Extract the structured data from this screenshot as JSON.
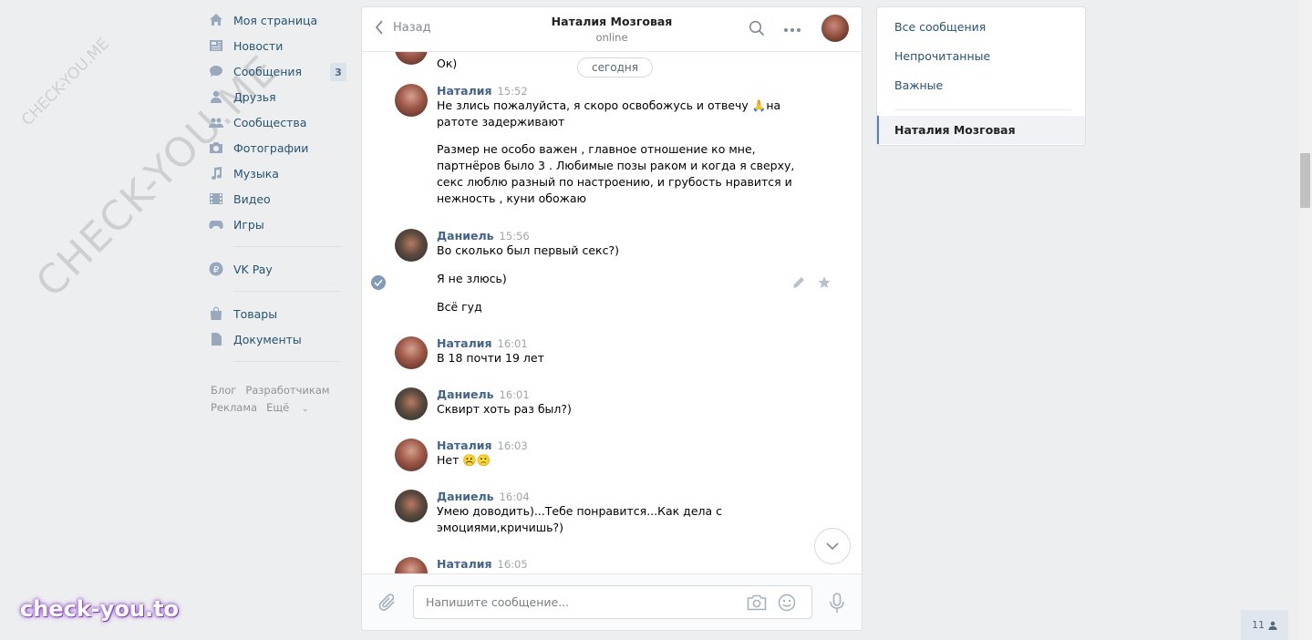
{
  "watermarks": {
    "big": "CHECK-YOU.ME",
    "small": "CHECK-YOU.ME",
    "brand": "check-you.to"
  },
  "nav": {
    "items": [
      {
        "label": "Моя страница",
        "icon": "home-icon"
      },
      {
        "label": "Новости",
        "icon": "news-icon"
      },
      {
        "label": "Сообщения",
        "icon": "messages-icon",
        "badge": "3"
      },
      {
        "label": "Друзья",
        "icon": "friends-icon"
      },
      {
        "label": "Сообщества",
        "icon": "groups-icon"
      },
      {
        "label": "Фотографии",
        "icon": "camera-icon"
      },
      {
        "label": "Музыка",
        "icon": "music-icon"
      },
      {
        "label": "Видео",
        "icon": "video-icon"
      },
      {
        "label": "Игры",
        "icon": "gamepad-icon"
      }
    ],
    "vkpay": "VK Pay",
    "goods": "Товары",
    "documents": "Документы",
    "footer": {
      "blog": "Блог",
      "developers": "Разработчикам",
      "ads": "Реклама",
      "more": "Ещё"
    }
  },
  "chat": {
    "back_label": "Назад",
    "title": "Наталия Мозговая",
    "status": "online",
    "date_pill": "сегодня",
    "partial_text": "Ок)",
    "messages": [
      {
        "author": "Наталия",
        "time": "15:52",
        "lines": [
          "Не злись пожалуйста, я скоро освобожусь и отвечу 🙏на",
          "ратоте задерживают"
        ],
        "para": [
          "Размер не особо важен , главное отношение ко мне,",
          "партнёров было 3 . Любимые позы раком и когда я сверху,",
          "секс люблю разный по настроению, и грубость нравится и",
          "нежность , куни обожаю"
        ]
      },
      {
        "author": "Даниель",
        "time": "15:56",
        "lines": [
          "Во сколько был первый секс?)"
        ],
        "extra": [
          "Я не злюсь)",
          "Всё гуд"
        ]
      },
      {
        "author": "Наталия",
        "time": "16:01",
        "lines": [
          "В 18 почти 19 лет"
        ]
      },
      {
        "author": "Даниель",
        "time": "16:01",
        "lines": [
          "Сквирт хоть раз был?)"
        ]
      },
      {
        "author": "Наталия",
        "time": "16:03",
        "lines": [
          "Нет ☹️🙁"
        ]
      },
      {
        "author": "Даниель",
        "time": "16:04",
        "lines": [
          "Умею доводить)...Тебе понравится...Как дела с",
          "эмоциями,кричишь?)"
        ]
      },
      {
        "author": "Наталия",
        "time": "16:05",
        "lines": []
      }
    ],
    "composer_placeholder": "Напишите сообщение..."
  },
  "right": {
    "all": "Все сообщения",
    "unread": "Непрочитанные",
    "important": "Важные",
    "active_dialog": "Наталия Мозговая"
  },
  "online_count": "11",
  "colors": {
    "link": "#285473",
    "author": "#42648b",
    "accent": "#5181b8"
  }
}
